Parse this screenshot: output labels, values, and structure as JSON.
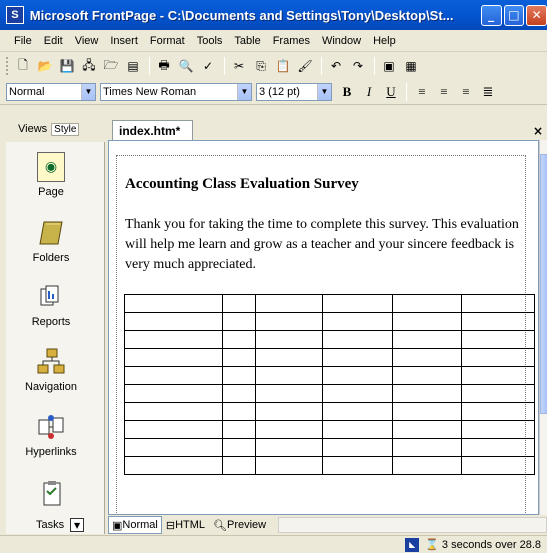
{
  "window": {
    "title": "Microsoft FrontPage - C:\\Documents and Settings\\Tony\\Desktop\\St...",
    "app_icon": "S"
  },
  "menu": [
    "File",
    "Edit",
    "View",
    "Insert",
    "Format",
    "Tools",
    "Table",
    "Frames",
    "Window",
    "Help"
  ],
  "format_toolbar": {
    "style_value": "Normal",
    "font_value": "Times New Roman",
    "size_value": "3 (12 pt)",
    "bold": "B",
    "italic": "I",
    "underline": "U"
  },
  "views_panel": {
    "label": "Views",
    "style_tab": "Style",
    "items": [
      "Page",
      "Folders",
      "Reports",
      "Navigation",
      "Hyperlinks",
      "Tasks"
    ]
  },
  "document": {
    "tab_label": "index.htm*",
    "title": "Accounting Class Evaluation Survey",
    "paragraph": "Thank you for taking the time to complete this survey.  This evaluation will help me learn and grow as a teacher and your sincere feedback is very much appreciated.",
    "table": {
      "rows": 10,
      "cols": 6
    }
  },
  "view_tabs": [
    "Normal",
    "HTML",
    "Preview"
  ],
  "status": {
    "text": "3 seconds over 28.8"
  },
  "colors": {
    "titlebar": "#0454d0",
    "accent": "#7f9db9"
  }
}
